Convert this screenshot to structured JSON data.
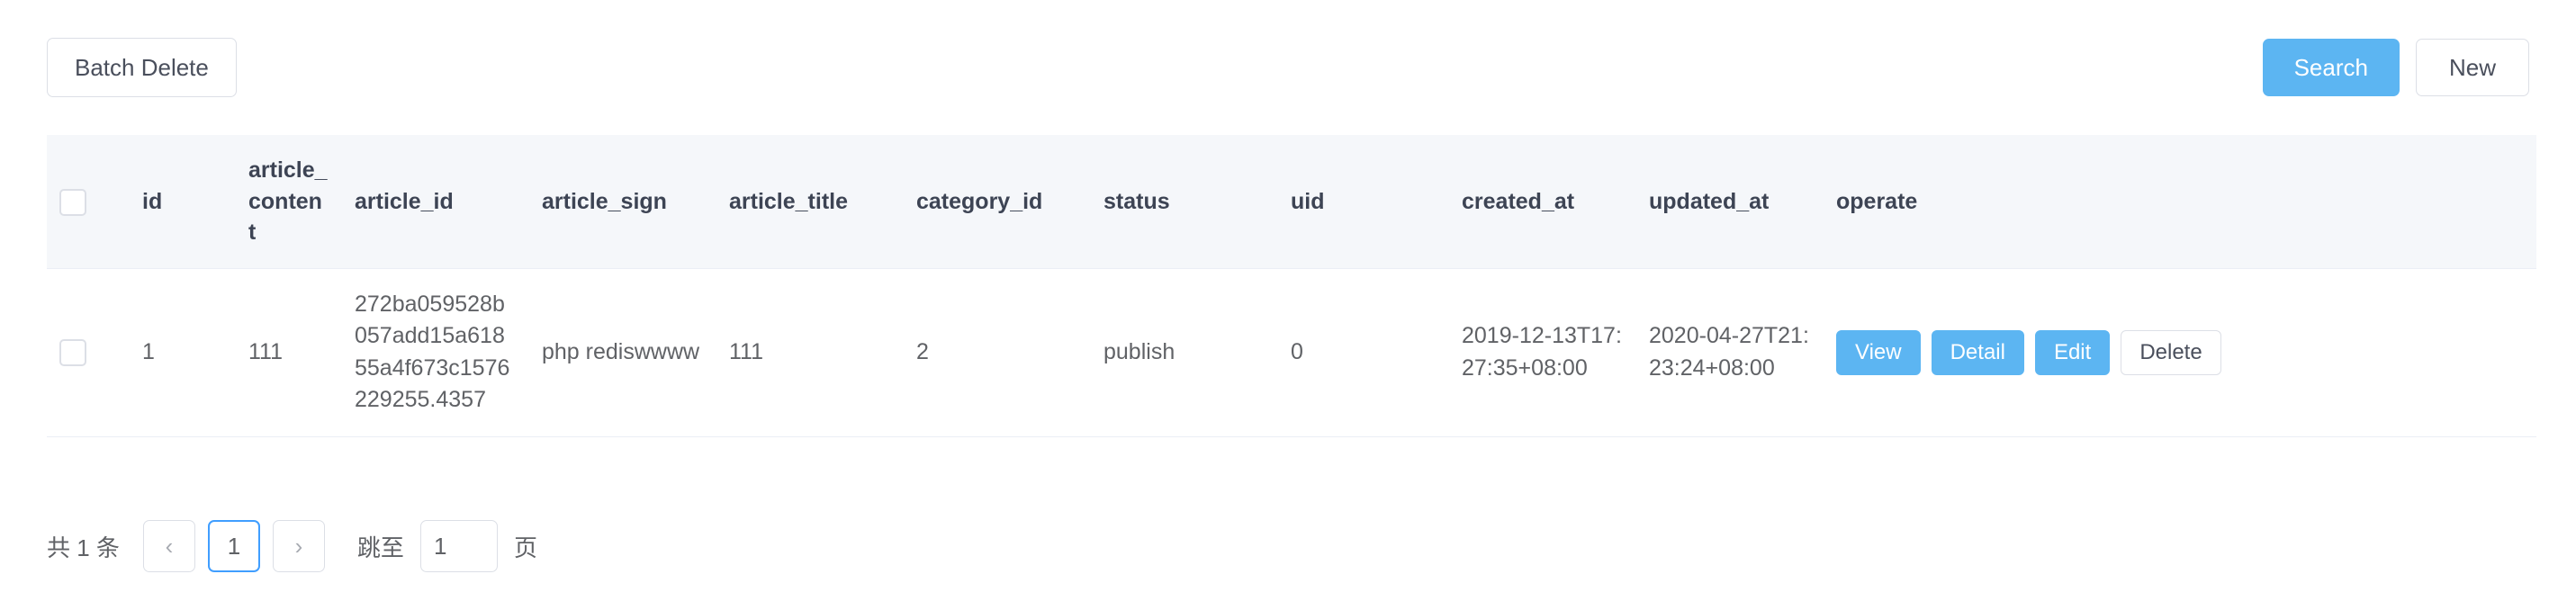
{
  "toolbar": {
    "batch_delete_label": "Batch Delete",
    "search_label": "Search",
    "new_label": "New",
    "primary_color": "#5cb5f2"
  },
  "table": {
    "columns": [
      {
        "key": "checkbox",
        "label": ""
      },
      {
        "key": "id",
        "label": "id"
      },
      {
        "key": "article_content",
        "label": "article_content"
      },
      {
        "key": "article_id",
        "label": "article_id"
      },
      {
        "key": "article_sign",
        "label": "article_sign"
      },
      {
        "key": "article_title",
        "label": "article_title"
      },
      {
        "key": "category_id",
        "label": "category_id"
      },
      {
        "key": "status",
        "label": "status"
      },
      {
        "key": "uid",
        "label": "uid"
      },
      {
        "key": "created_at",
        "label": "created_at"
      },
      {
        "key": "updated_at",
        "label": "updated_at"
      },
      {
        "key": "operate",
        "label": "operate"
      }
    ],
    "rows": [
      {
        "id": "1",
        "article_content": "111",
        "article_id": "272ba059528b057add15a61855a4f673c1576229255.4357",
        "article_sign": "php rediswwww",
        "article_title": "111",
        "category_id": "2",
        "status": "publish",
        "uid": "0",
        "created_at": "2019-12-13T17:27:35+08:00",
        "updated_at": "2020-04-27T21:23:24+08:00",
        "operate": {
          "view_label": "View",
          "detail_label": "Detail",
          "edit_label": "Edit",
          "delete_label": "Delete"
        }
      }
    ]
  },
  "pagination": {
    "total_text": "共 1 条",
    "prev_icon": "chevron-left-icon",
    "prev_glyph": "‹",
    "next_icon": "chevron-right-icon",
    "next_glyph": "›",
    "current_page": "1",
    "jump_label": "跳至",
    "jump_value": "1",
    "jump_unit": "页",
    "active_color": "#409eff"
  }
}
